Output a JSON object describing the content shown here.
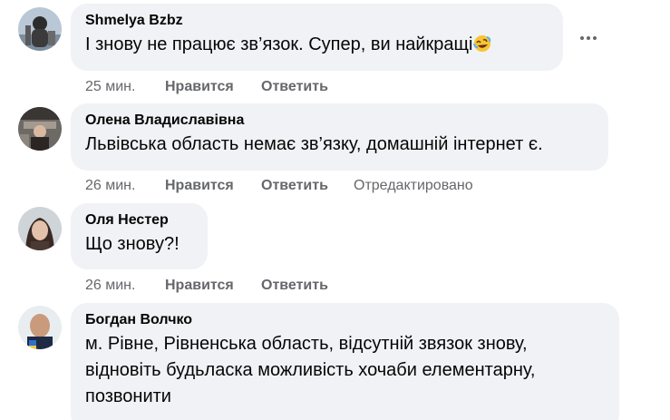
{
  "comments": [
    {
      "author": "Shmelya Bzbz",
      "text": "І знову не працює зв’язок. Супер, ви найкращі",
      "emoji": "rolling-on-the-floor-laughing-emoji",
      "time": "25 мин.",
      "like": "Нравится",
      "reply": "Ответить",
      "edited": ""
    },
    {
      "author": "Олена Владиславівна",
      "text": "Львівська область немає зв’язку, домашній інтернет є.",
      "time": "26 мин.",
      "like": "Нравится",
      "reply": "Ответить",
      "edited": "Отредактировано"
    },
    {
      "author": "Оля Нестер",
      "text": "Що знову?!",
      "time": "26 мин.",
      "like": "Нравится",
      "reply": "Ответить",
      "edited": ""
    },
    {
      "author": "Богдан Волчко",
      "text_lines": [
        "м. Рівне, Рівненська область, відсутній звязок знову,",
        "відновіть будьласка можливість хочаби елементарну,",
        "позвонити"
      ]
    }
  ],
  "icons": {
    "more_options": "more-horizontal-icon"
  },
  "colors": {
    "bubble": "#f0f2f5",
    "text": "#050505",
    "secondary": "#65676b"
  }
}
